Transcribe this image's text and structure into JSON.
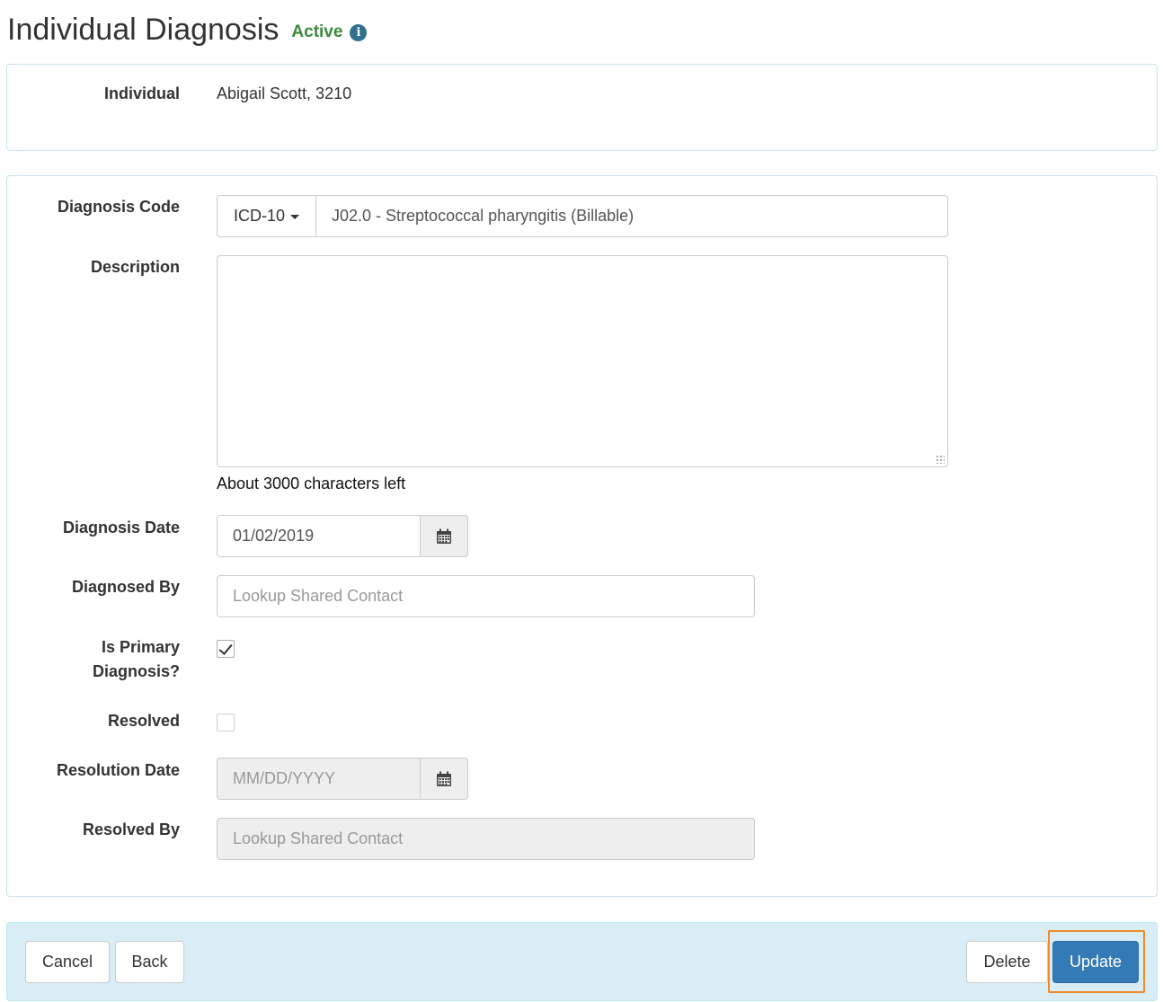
{
  "header": {
    "title": "Individual Diagnosis",
    "status": "Active",
    "info_icon": "info-circle-icon"
  },
  "individual": {
    "label": "Individual",
    "value": "Abigail Scott, 3210"
  },
  "form": {
    "diagnosis_code": {
      "label": "Diagnosis Code",
      "code_type": "ICD-10",
      "value": "J02.0 - Streptococcal pharyngitis (Billable)"
    },
    "description": {
      "label": "Description",
      "value": "",
      "chars_left": "About 3000 characters left"
    },
    "diagnosis_date": {
      "label": "Diagnosis Date",
      "value": "01/02/2019",
      "icon": "calendar-icon"
    },
    "diagnosed_by": {
      "label": "Diagnosed By",
      "placeholder": "Lookup Shared Contact"
    },
    "is_primary": {
      "label_line1": "Is Primary",
      "label_line2": "Diagnosis?",
      "checked": true
    },
    "resolved": {
      "label": "Resolved",
      "checked": false
    },
    "resolution_date": {
      "label": "Resolution Date",
      "placeholder": "MM/DD/YYYY",
      "icon": "calendar-icon"
    },
    "resolved_by": {
      "label": "Resolved By",
      "placeholder": "Lookup Shared Contact"
    }
  },
  "footer": {
    "cancel_label": "Cancel",
    "back_label": "Back",
    "delete_label": "Delete",
    "update_label": "Update"
  },
  "colors": {
    "status_active": "#3c8a3c",
    "primary": "#337ab7",
    "footer_bg": "#d9edf7",
    "focus_outline": "#f08a24"
  }
}
